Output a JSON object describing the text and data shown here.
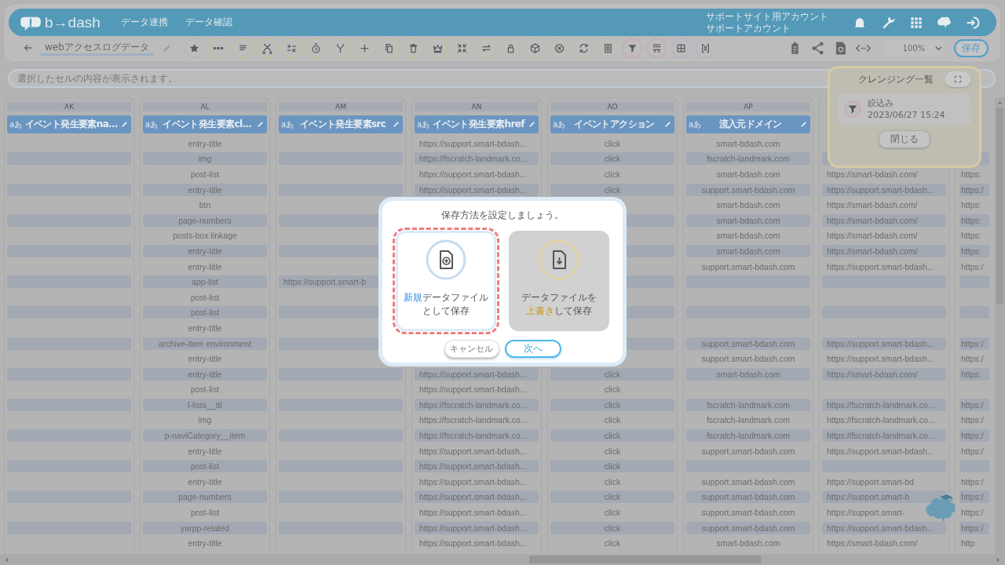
{
  "header": {
    "logo": "b→dash",
    "nav": [
      {
        "label": "データ連携"
      },
      {
        "label": "データ確認"
      }
    ],
    "account": [
      "サポートサイト用アカウント",
      "サポートアカウント"
    ]
  },
  "toolbar": {
    "title": "webアクセスログデータ",
    "zoom": "100%",
    "save": "保存"
  },
  "cell_info": {
    "placeholder": "選択したセルの内容が表示されます。"
  },
  "columns": [
    {
      "letter": "AK",
      "type_badge": "aあ",
      "title": "イベント発生要素na…",
      "kind": "text",
      "cells": [
        null,
        null,
        null,
        null,
        null,
        null,
        null,
        null,
        null,
        null,
        null,
        null,
        null,
        null,
        null,
        null,
        null,
        null,
        null,
        null,
        null,
        null,
        null,
        null,
        null,
        null,
        null
      ]
    },
    {
      "letter": "AL",
      "type_badge": "aあ",
      "title": "イベント発生要素cl…",
      "kind": "text",
      "cells": [
        "entry-title",
        "img",
        "post-list",
        "entry-title",
        "btn",
        "page-numbers",
        "posts-box linkage",
        "entry-title",
        "entry-title",
        "app-list",
        "post-list",
        "post-list",
        "entry-title",
        "archive-item environment",
        "entry-title",
        "entry-title",
        "post-list",
        "l-lists__ttl",
        "img",
        "p-naviCategory__item",
        "entry-title",
        "post-list",
        "entry-title",
        "page-numbers",
        "post-list",
        "yarpp-related",
        "entry-title"
      ]
    },
    {
      "letter": "AM",
      "type_badge": "aあ",
      "title": "イベント発生要素src",
      "kind": "url",
      "cells": [
        null,
        null,
        null,
        null,
        null,
        null,
        null,
        null,
        null,
        "https://support.smart-b",
        null,
        null,
        null,
        null,
        null,
        null,
        null,
        null,
        null,
        null,
        null,
        null,
        null,
        null,
        null,
        null,
        null
      ]
    },
    {
      "letter": "AN",
      "type_badge": "aあ",
      "title": "イベント発生要素href",
      "kind": "url",
      "cells": [
        "https://support.smart-bdash...",
        "https://fscratch-landmark.co...",
        "https://support.smart-bdash...",
        "https://support.smart-bdash...",
        null,
        null,
        null,
        null,
        null,
        null,
        null,
        null,
        null,
        null,
        null,
        "https://support.smart-bdash...",
        "https://support.smart-bdash...",
        "https://fscratch-landmark.co...",
        "https://fscratch-landmark.co...",
        "https://fscratch-landmark.co...",
        "https://support.smart-bdash...",
        "https://support.smart-bdash...",
        "https://support.smart-bdash...",
        "https://support.smart-bdash...",
        "https://support.smart-bdash...",
        "https://support.smart-bdash...",
        "https://support.smart-bdash..."
      ]
    },
    {
      "letter": "AO",
      "type_badge": "aあ",
      "title": "イベントアクション",
      "kind": "text",
      "cells": [
        "click",
        "click",
        "click",
        "click",
        null,
        null,
        null,
        null,
        null,
        null,
        null,
        null,
        null,
        null,
        null,
        "click",
        "click",
        "click",
        "click",
        "click",
        "click",
        "click",
        "click",
        "click",
        "click",
        "click",
        "click"
      ]
    },
    {
      "letter": "AP",
      "type_badge": "aあ",
      "title": "流入元ドメイン",
      "kind": "text",
      "cells": [
        "smart-bdash.com",
        "fscratch-landmark.com",
        "smart-bdash.com",
        "support.smart-bdash.com",
        "smart-bdash.com",
        "smart-bdash.com",
        "smart-bdash.com",
        "smart-bdash.com",
        "support.smart-bdash.com",
        null,
        null,
        null,
        null,
        "support.smart-bdash.com",
        "support.smart-bdash.com",
        "smart-bdash.com",
        null,
        "fscratch-landmark.com",
        "fscratch-landmark.com",
        "fscratch-landmark.com",
        "support.smart-bdash.com",
        null,
        "support.smart-bdash.com",
        "support.smart-bdash.com",
        "support.smart-bdash.com",
        "support.smart-bdash.com",
        "smart-bdash.com"
      ]
    },
    {
      "kind": "url",
      "cells": [
        null,
        null,
        "https://smart-bdash.com/",
        "https://support.smart-bdash...",
        "https://smart-bdash.com/",
        "https://smart-bdash.com/",
        "https://smart-bdash.com/",
        "https://smart-bdash.com/",
        "https://support.smart-bdash...",
        null,
        null,
        null,
        null,
        "https://support.smart-bdash...",
        "https://support.smart-bdash...",
        "https://smart-bdash.com/",
        null,
        "https://fscratch-landmark.co...",
        "https://fscratch-landmark.co...",
        "https://fscratch-landmark.co...",
        "https://support.smart-bdash...",
        null,
        "https://support.smart-bd",
        "https://support.smart-b",
        "https://support.smart-",
        "https://support.smart-bdash...",
        "https://smart-bdash.com/"
      ]
    },
    {
      "kind": "partial",
      "cells": [
        null,
        null,
        "https:",
        "https:/",
        "https:",
        "https:",
        "https:",
        "https:",
        "https:/",
        null,
        null,
        null,
        null,
        "https:/",
        "https:/",
        "https:",
        null,
        "https:/",
        "https:/",
        "https:/",
        "https:/",
        null,
        "https:/",
        "https:/",
        "https:/",
        "https:/",
        "http"
      ]
    }
  ],
  "cleansing_panel": {
    "title": "クレンジング一覧",
    "items": [
      {
        "label": "絞込み",
        "time": "2023/06/27 15:24"
      }
    ],
    "close": "閉じる"
  },
  "dialog": {
    "title": "保存方法を設定しましょう。",
    "options": [
      {
        "kind": "new",
        "selected": true,
        "lines": [
          [
            {
              "text": "新規",
              "accent": true
            },
            {
              "text": "データファイル",
              "accent": false
            }
          ],
          [
            {
              "text": "として保存",
              "accent": false
            }
          ]
        ]
      },
      {
        "kind": "overwrite",
        "selected": false,
        "lines": [
          [
            {
              "text": "データファイルを",
              "accent": false
            }
          ],
          [
            {
              "text": "上書き",
              "accent": true
            },
            {
              "text": "して保存",
              "accent": false
            }
          ]
        ]
      }
    ],
    "cancel": "キャンセル",
    "next": "次へ"
  }
}
